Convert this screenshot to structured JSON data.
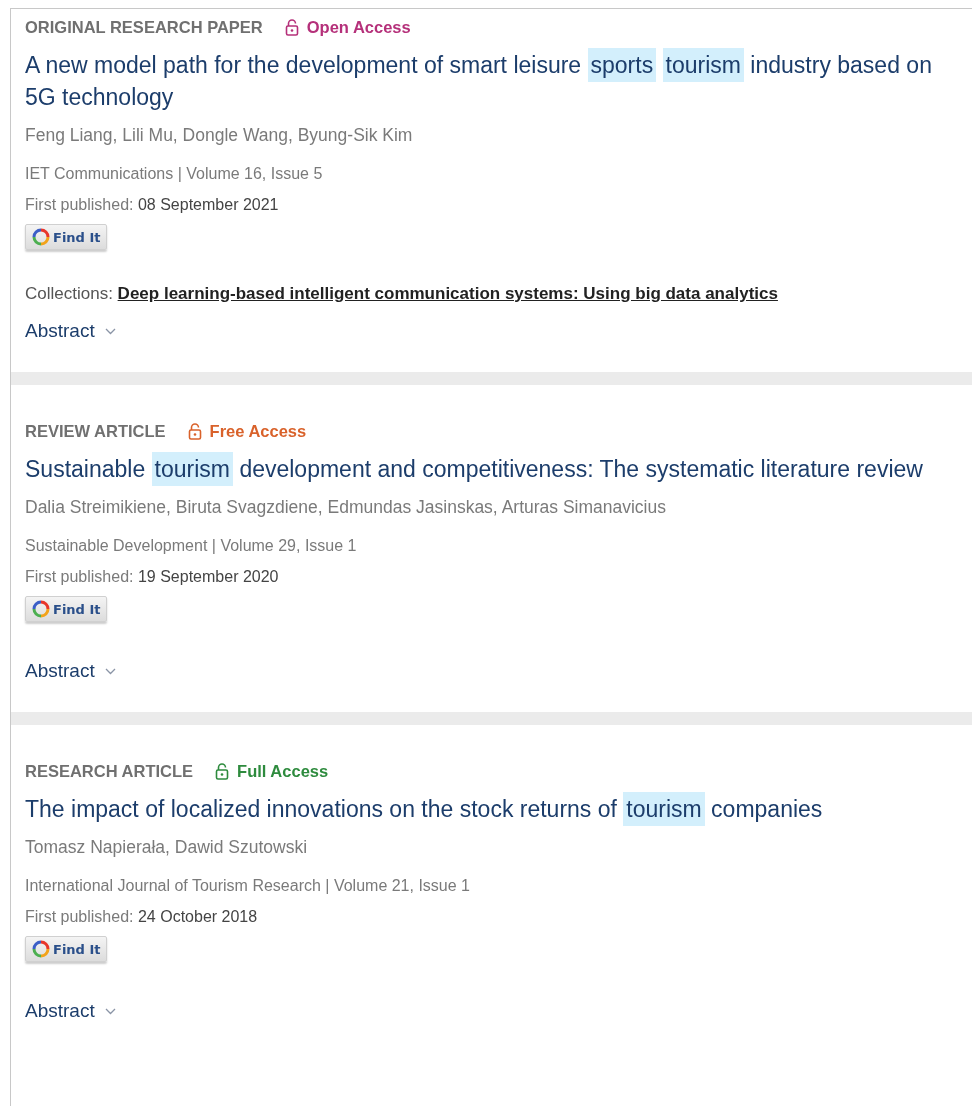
{
  "articles": [
    {
      "type": "ORIGINAL RESEARCH PAPER",
      "access": {
        "label": "Open Access",
        "color": "#b5307a"
      },
      "title": [
        {
          "text": "A new model path for the development of smart leisure ",
          "highlighted": false
        },
        {
          "text": "sports",
          "highlighted": true
        },
        {
          "text": "tourism",
          "highlighted": true
        },
        {
          "text": " industry based on 5G technology",
          "highlighted": false
        }
      ],
      "authors": "Feng Liang, Lili Mu, Dongle Wang, Byung-Sik Kim",
      "journal": "IET Communications | Volume 16, Issue 5",
      "published_label": "First published:",
      "published_date": "08 September 2021",
      "find_it": "Find It",
      "collections": {
        "label": "Collections:",
        "link": "Deep learning-based intelligent communication systems: Using big data analytics"
      },
      "abstract": "Abstract"
    },
    {
      "type": "REVIEW ARTICLE",
      "access": {
        "label": "Free Access",
        "color": "#d9622b"
      },
      "title": [
        {
          "text": "Sustainable ",
          "highlighted": false
        },
        {
          "text": "tourism",
          "highlighted": true
        },
        {
          "text": " development and competitiveness: The systematic literature review",
          "highlighted": false
        }
      ],
      "authors": "Dalia Streimikiene, Biruta Svagzdiene, Edmundas Jasinskas, Arturas Simanavicius",
      "journal": "Sustainable Development | Volume 29, Issue 1",
      "published_label": "First published:",
      "published_date": "19 September 2020",
      "find_it": "Find It",
      "abstract": "Abstract"
    },
    {
      "type": "RESEARCH ARTICLE",
      "access": {
        "label": "Full Access",
        "color": "#2e8b3e"
      },
      "title": [
        {
          "text": "The impact of localized innovations on the stock returns of ",
          "highlighted": false
        },
        {
          "text": "tourism",
          "highlighted": true
        },
        {
          "text": " companies",
          "highlighted": false
        }
      ],
      "authors": "Tomasz Napierała, Dawid Szutowski",
      "journal": "International Journal of Tourism Research | Volume 21, Issue 1",
      "published_label": "First published:",
      "published_date": "24 October 2018",
      "find_it": "Find It",
      "abstract": "Abstract"
    }
  ]
}
